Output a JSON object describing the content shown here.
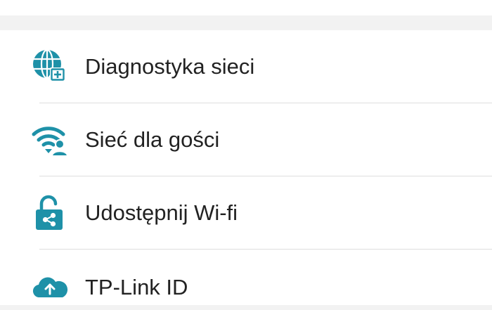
{
  "colors": {
    "icon_accent": "#1e91a8",
    "text": "#222222",
    "divider": "#dedede",
    "section_background": "#f2f2f2"
  },
  "menu": {
    "items": [
      {
        "label": "Diagnostyka sieci",
        "icon": "globe-diagnostics-icon"
      },
      {
        "label": "Sieć dla gości",
        "icon": "wifi-guest-icon"
      },
      {
        "label": "Udostępnij Wi-fi",
        "icon": "unlock-share-icon"
      },
      {
        "label": "TP-Link ID",
        "icon": "cloud-upload-icon"
      }
    ]
  }
}
